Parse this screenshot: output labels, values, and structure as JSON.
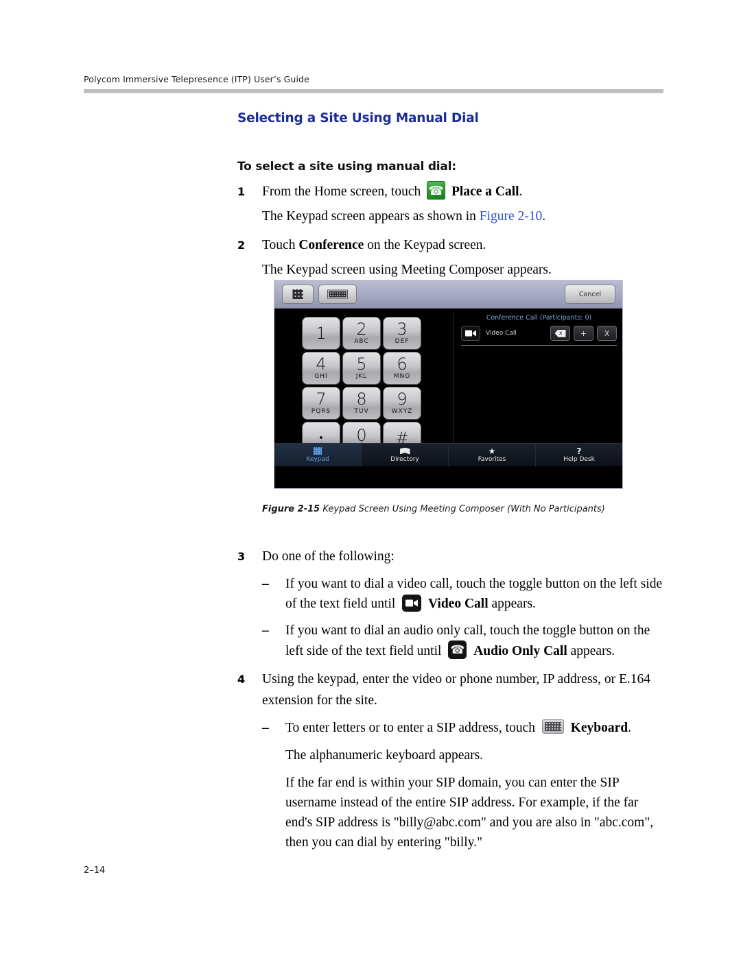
{
  "header": {
    "running_head": "Polycom Immersive Telepresence (ITP) User’s Guide"
  },
  "footer": {
    "page_number": "2–14"
  },
  "section": {
    "title": "Selecting a Site Using Manual Dial",
    "subtitle": "To select a site using manual dial:"
  },
  "steps": [
    {
      "number": "1",
      "text_before": "From the Home screen, touch",
      "icon": "green-phone-icon",
      "bold_label": "Place a Call",
      "text_after": ".",
      "follow_before": "The Keypad screen appears as shown in ",
      "follow_xref": "Figure 2-10",
      "follow_after": "."
    },
    {
      "number": "2",
      "text_before": "Touch ",
      "bold_label": "Conference",
      "text_after": " on the Keypad screen.",
      "follow": "The Keypad screen using Meeting Composer appears."
    },
    {
      "number": "3",
      "text": "Do one of the following:",
      "bullets": [
        {
          "dash": "–",
          "text_before": "If you want to dial a video call, touch the toggle button on the left side of the text field until",
          "icon": "video-camera-icon",
          "bold_label": "Video Call",
          "text_after": " appears."
        },
        {
          "dash": "–",
          "text_before": "If you want to dial an audio only call, touch the toggle button on the left side of the text field until",
          "icon": "dark-phone-icon",
          "bold_label": "Audio Only Call",
          "text_after": " appears."
        }
      ]
    },
    {
      "number": "4",
      "text": "Using the keypad, enter the video or phone number, IP address, or E.164 extension for the site.",
      "bullets": [
        {
          "dash": "–",
          "text_before": "To enter letters or to enter a SIP address, touch",
          "icon": "keyboard-icon",
          "bold_label": "Keyboard",
          "text_after": "."
        }
      ],
      "paragraphs": [
        "The alphanumeric keyboard appears.",
        "If the far end is within your SIP domain, you can enter the SIP username instead of the entire SIP address. For example, if the far end's SIP address is \"billy@abc.com\" and you are also in \"abc.com\", then you can dial by entering \"billy.\""
      ]
    }
  ],
  "figure": {
    "caption_number": "Figure 2-15",
    "caption_text": "Keypad Screen Using Meeting Composer (With No Participants)",
    "device": {
      "toolbar": {
        "keypad_button_icon": "keypad-grid-icon",
        "keyboard_button_icon": "keyboard-icon",
        "cancel_label": "Cancel"
      },
      "keypad_keys": [
        {
          "main": "1",
          "sub": ""
        },
        {
          "main": "2",
          "sub": "ABC"
        },
        {
          "main": "3",
          "sub": "DEF"
        },
        {
          "main": "4",
          "sub": "GHI"
        },
        {
          "main": "5",
          "sub": "JKL"
        },
        {
          "main": "6",
          "sub": "MNO"
        },
        {
          "main": "7",
          "sub": "PQRS"
        },
        {
          "main": "8",
          "sub": "TUV"
        },
        {
          "main": "9",
          "sub": "WXYZ"
        },
        {
          "main": "•",
          "sub": "*"
        },
        {
          "main": "0",
          "sub": "+"
        },
        {
          "main": "#",
          "sub": ""
        }
      ],
      "conference": {
        "title": "Conference Call (Participants: 0)",
        "mode_icon": "video-camera-icon",
        "mode_label": "Video Call",
        "actions": [
          {
            "name": "backspace",
            "label": ""
          },
          {
            "name": "add",
            "label": "+"
          },
          {
            "name": "clear",
            "label": "X"
          }
        ]
      },
      "tabs": [
        {
          "label": "Keypad",
          "icon": "keypad-grid-icon",
          "active": true
        },
        {
          "label": "Directory",
          "icon": "book-icon",
          "active": false
        },
        {
          "label": "Favorites",
          "icon": "star-icon",
          "active": false
        },
        {
          "label": "Help Desk",
          "icon": "question-mark-icon",
          "active": false
        }
      ]
    }
  },
  "colors": {
    "heading_blue": "#1b2c96",
    "xref_blue": "#2c4fd0",
    "rule_gray": "#bfbfbf",
    "tab_active_blue": "#5c9ce6"
  }
}
